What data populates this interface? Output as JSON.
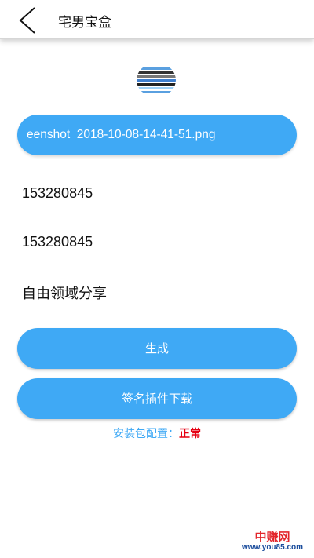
{
  "header": {
    "title": "宅男宝盒",
    "back_icon": "chevron-left-icon"
  },
  "thumbnail": {
    "icon": "image-thumbnail"
  },
  "file": {
    "name": "eenshot_2018-10-08-14-41-51.png"
  },
  "fields": [
    {
      "value": "153280845"
    },
    {
      "value": "153280845"
    },
    {
      "value": "自由领域分享"
    }
  ],
  "buttons": {
    "generate": "生成",
    "download_plugin": "签名插件下载"
  },
  "status": {
    "label": "安装包配置：",
    "value": "正常"
  },
  "watermark": {
    "top": "中赚网",
    "bottom": "www.you85.com"
  },
  "colors": {
    "accent": "#3fa9f5",
    "status_ok": "#e60012",
    "watermark_red": "#e3262c",
    "watermark_blue": "#1a4c9c"
  }
}
